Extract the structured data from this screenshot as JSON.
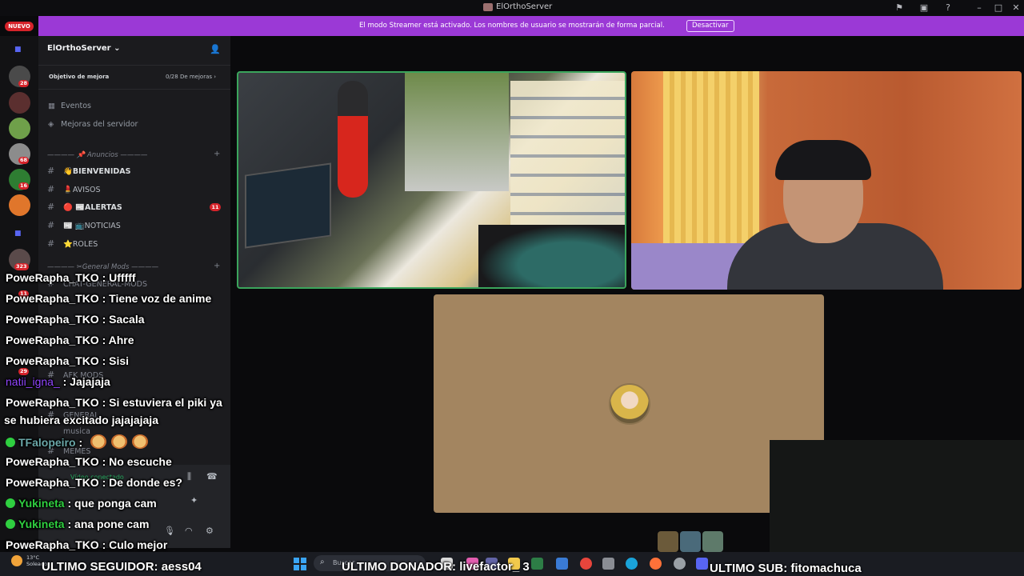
{
  "window": {
    "title": "ElOrthoServer"
  },
  "banner": {
    "message": "El modo Streamer está activado. Los nombres de usuario se mostrarán de forma parcial.",
    "button": "Desactivar"
  },
  "rail": {
    "nuevo": "NUEVO",
    "badges": [
      "28",
      "68",
      "16",
      "323",
      "11",
      "29"
    ]
  },
  "sidebar": {
    "server_name": "ElOrthoServer",
    "boost_goal": "Objetivo de mejora",
    "boost_count": "0/28 De mejoras",
    "nav": [
      {
        "icon": "calendar-icon",
        "label": "Eventos"
      },
      {
        "icon": "boost-icon",
        "label": "Mejoras del servidor"
      }
    ],
    "categories": [
      {
        "label": "———— 📌 Anuncios ————"
      },
      {
        "label": "———— ✂General Mods ————"
      }
    ],
    "channels": [
      {
        "label": "👋BIENVENIDAS",
        "badge": ""
      },
      {
        "label": "💄AVISOS",
        "badge": ""
      },
      {
        "label": "🔴 📰ALERTAS",
        "badge": "11"
      },
      {
        "label": "📰 📺NOTICIAS",
        "badge": ""
      },
      {
        "label": "⭐ROLES",
        "badge": ""
      }
    ],
    "hidden_channels": [
      "CHAT-GENERAL-MODS",
      "AFK MODS",
      "GENERAL",
      "musica",
      "MEMES"
    ],
    "voice_status": "Vídeo conectado",
    "user_status": "Invisible"
  },
  "chat": [
    {
      "user": "PoweRapha_TKO",
      "text": " : Ufffff",
      "style": "white"
    },
    {
      "user": "PoweRapha_TKO",
      "text": " : Tiene voz de anime",
      "style": "white"
    },
    {
      "user": "PoweRapha_TKO",
      "text": " : Sacala",
      "style": "white"
    },
    {
      "user": "PoweRapha_TKO",
      "text": " : Ahre",
      "style": "white"
    },
    {
      "user": "PoweRapha_TKO",
      "text": " : Sisi",
      "style": "white"
    },
    {
      "user": "natii_igna_",
      "text": " : Jajajaja",
      "style": "purple"
    },
    {
      "user": "PoweRapha_TKO",
      "text": " : Si estuviera el piki ya",
      "style": "white"
    },
    {
      "user": "",
      "text": "se hubiera excitado jajajajaja",
      "style": "wrap"
    },
    {
      "user": "TFalopeiro",
      "text": " : ",
      "style": "teal"
    },
    {
      "user": "PoweRapha_TKO",
      "text": " : No escuche",
      "style": "white"
    },
    {
      "user": "PoweRapha_TKO",
      "text": " : De donde es?",
      "style": "white"
    },
    {
      "user": "Yukineta",
      "text": " : que ponga cam",
      "style": "green"
    },
    {
      "user": "Yukineta",
      "text": " : ana pone cam",
      "style": "green"
    },
    {
      "user": "PoweRapha_TKO",
      "text": " : Culo mejor",
      "style": "white"
    }
  ],
  "taskbar": {
    "weather_temp": "13°C",
    "weather_desc": "Soleado",
    "search_placeholder": "Buscar"
  },
  "ticker": {
    "follower": "ULTIMO SEGUIDOR: aess04",
    "donor": "ULTIMO DONADOR: livefactor_ 3",
    "sub": "ULTIMO SUB: fitomachuca"
  }
}
